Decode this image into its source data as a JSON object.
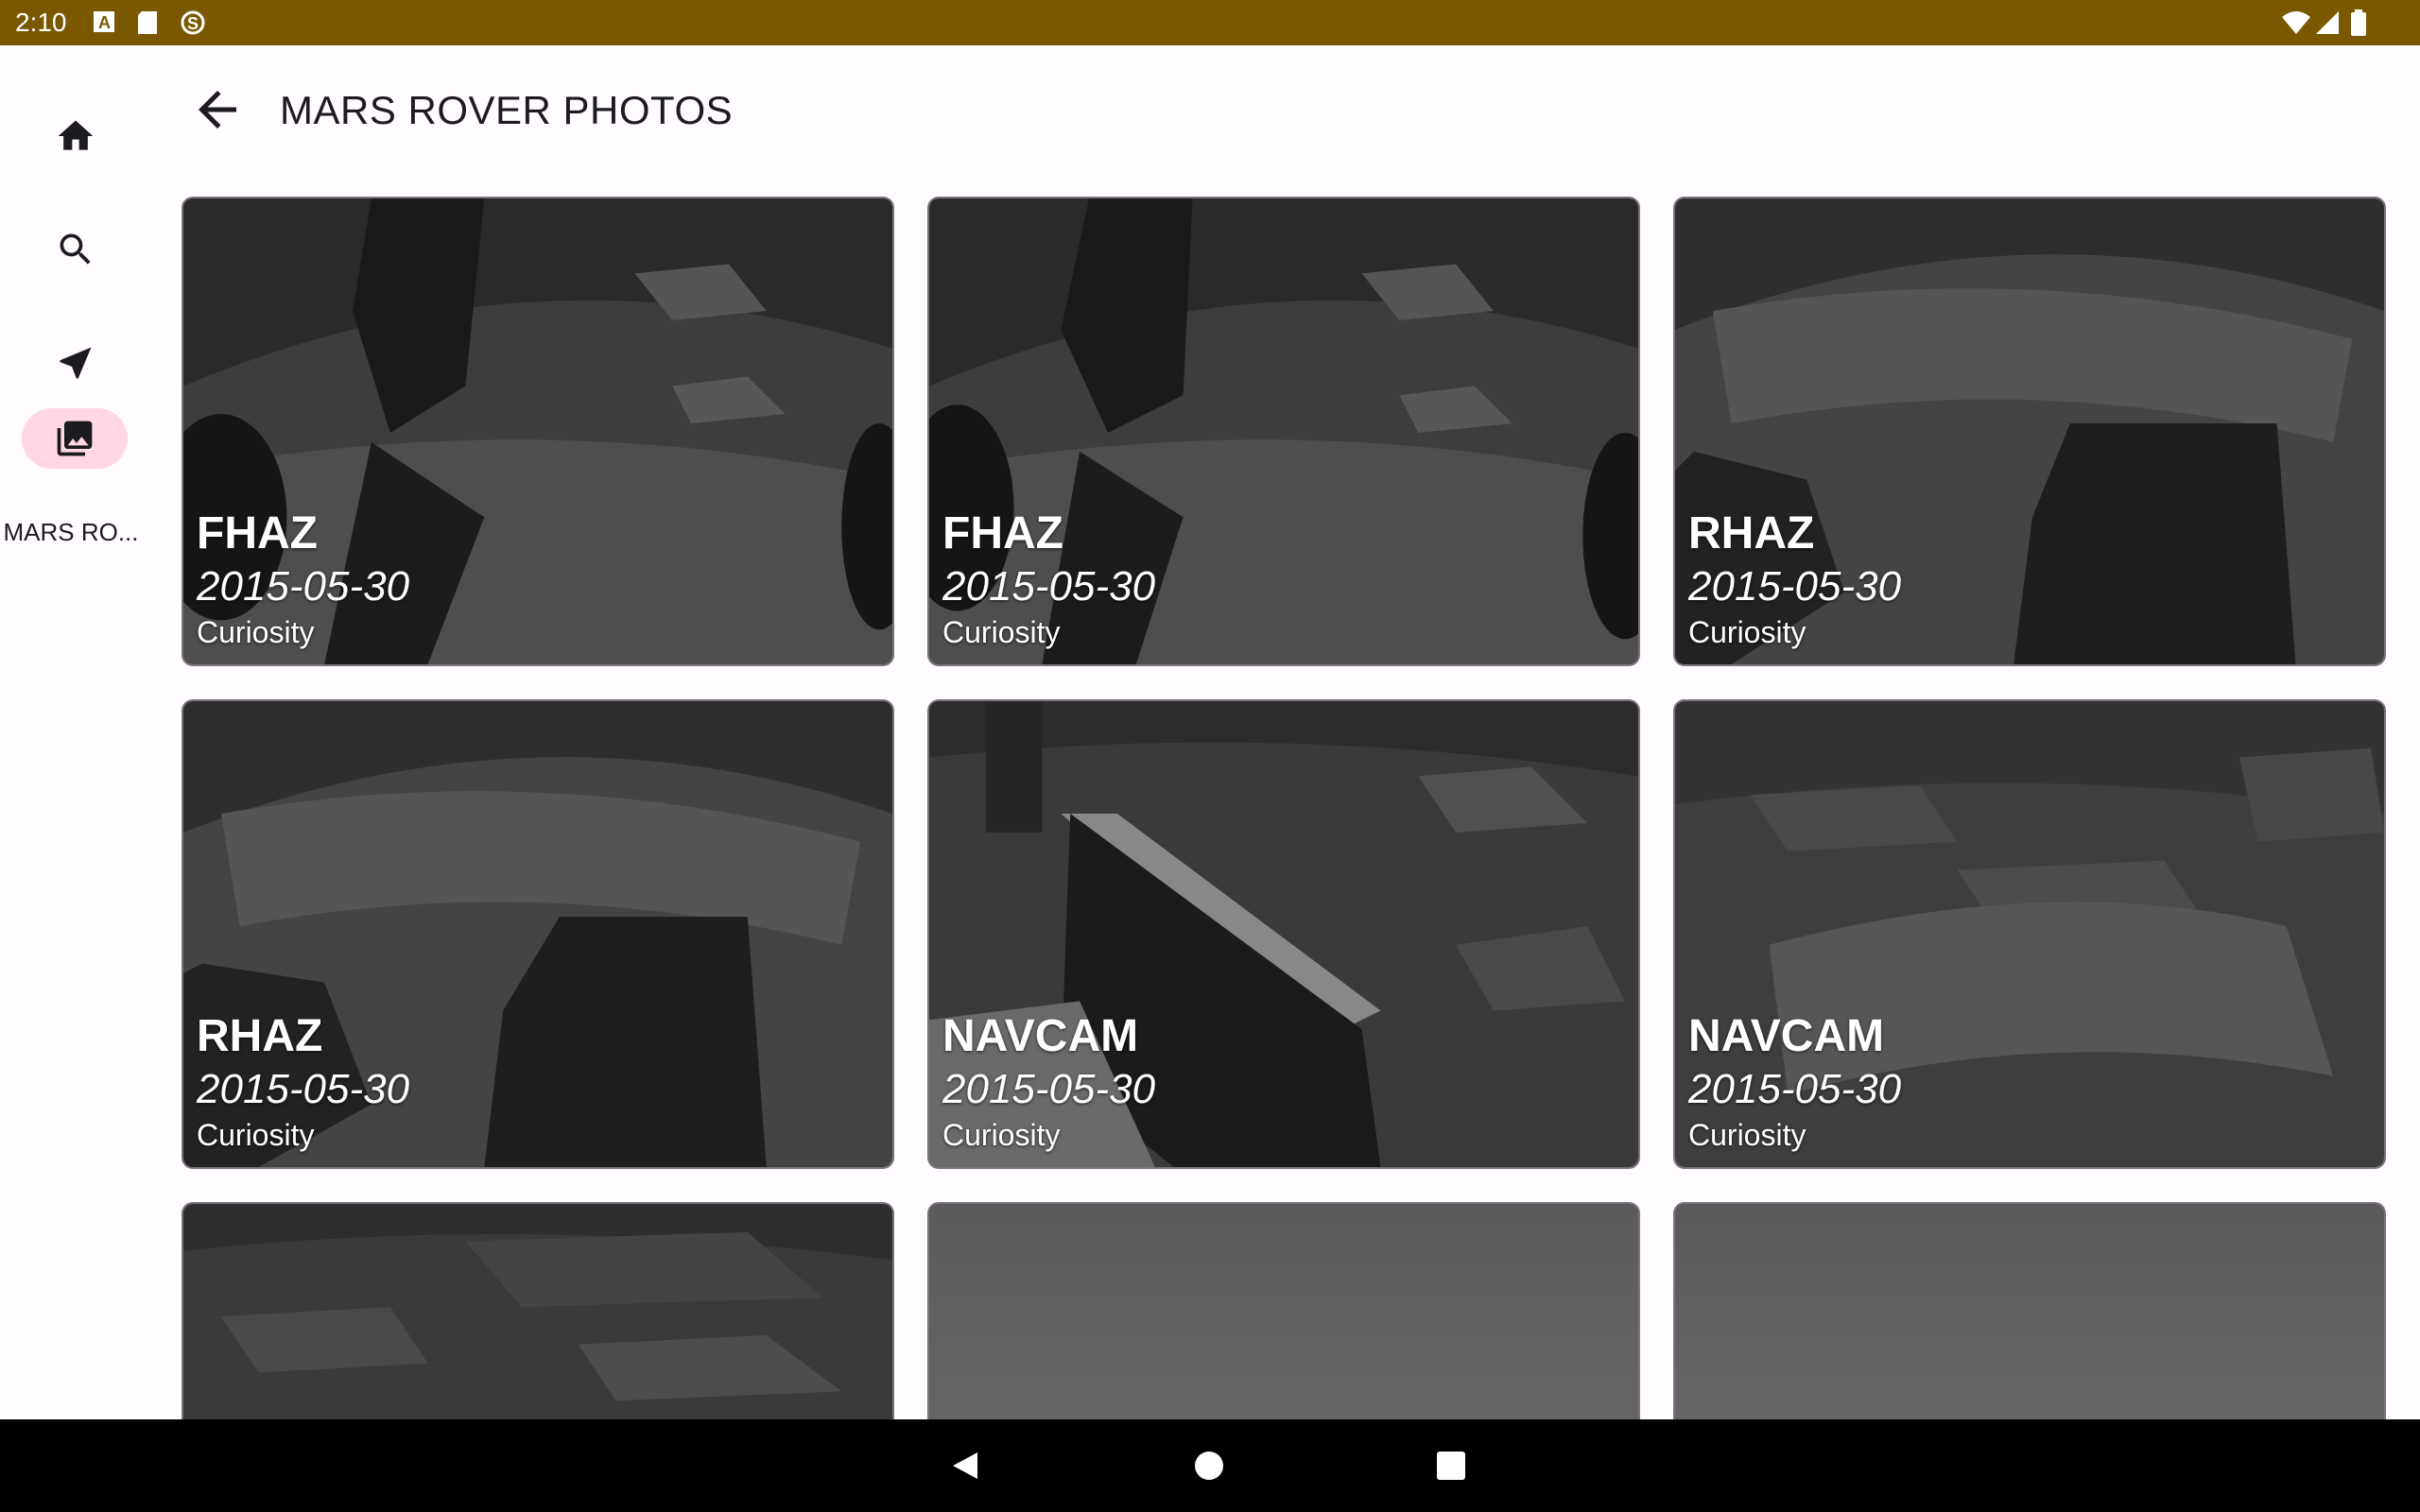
{
  "status_bar": {
    "time": "2:10"
  },
  "nav_rail": {
    "items": [
      {
        "icon": "home-icon"
      },
      {
        "icon": "search-icon"
      },
      {
        "icon": "navigation-icon"
      },
      {
        "icon": "photo-library-icon",
        "label": "MARS RO..."
      }
    ]
  },
  "header": {
    "title": "MARS ROVER PHOTOS"
  },
  "photos": [
    {
      "camera": "FHAZ",
      "date": "2015-05-30",
      "rover": "Curiosity"
    },
    {
      "camera": "FHAZ",
      "date": "2015-05-30",
      "rover": "Curiosity"
    },
    {
      "camera": "RHAZ",
      "date": "2015-05-30",
      "rover": "Curiosity"
    },
    {
      "camera": "RHAZ",
      "date": "2015-05-30",
      "rover": "Curiosity"
    },
    {
      "camera": "NAVCAM",
      "date": "2015-05-30",
      "rover": "Curiosity"
    },
    {
      "camera": "NAVCAM",
      "date": "2015-05-30",
      "rover": "Curiosity"
    }
  ],
  "colors": {
    "status_bar": "#7a5800",
    "selected_pill": "#ffd8e4",
    "background": "#fffbfe"
  }
}
